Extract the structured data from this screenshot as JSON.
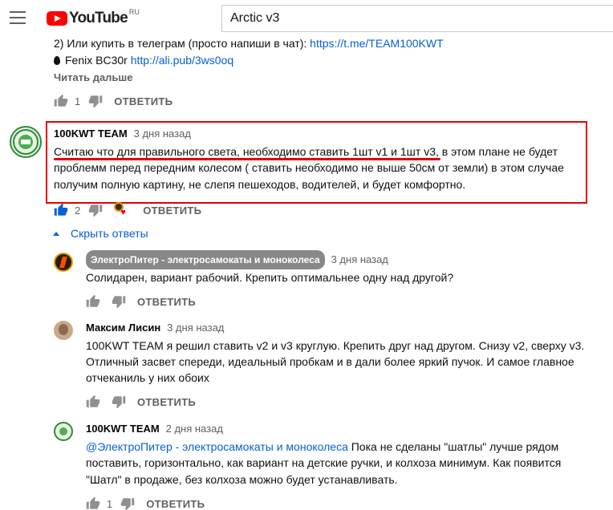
{
  "header": {
    "logo_text": "YouTube",
    "logo_region": "RU",
    "search_query": "Arctic v3"
  },
  "prev_comment": {
    "line1_text": "2) Или купить в телеграм (просто напиши в чат): ",
    "line1_link": "https://t.me/TEAM100KWT",
    "line2_text": "Fenix BC30r ",
    "line2_link": "http://ali.pub/3ws0oq",
    "read_more": "Читать дальше",
    "likes": "1",
    "reply": "ОТВЕТИТЬ"
  },
  "main_comment": {
    "author": "100KWT TEAM",
    "time": "3 дня назад",
    "lines": [
      "Считаю что для правильного света, необходимо ставить 1шт v1 и 1шт v3, в этом плане не будет",
      "проблемм перед передним колесом ( ставить необходимо не выше 50см от земли)  в этом случае",
      "получим полную картину, не слепя пешеходов, водителей, и будет комфортно."
    ],
    "likes": "2",
    "reply": "ОТВЕТИТЬ",
    "hide_replies": "Скрыть ответы"
  },
  "replies": [
    {
      "author": "ЭлектроПитер - электросамокаты и моноколеса",
      "time": "3 дня назад",
      "lines": [
        "Солидарен, вариант рабочий. Крепить оптимальнее одну над другой?"
      ],
      "likes": "",
      "reply": "ОТВЕТИТЬ"
    },
    {
      "author": "Максим Лисин",
      "time": "3 дня назад",
      "lines": [
        "100KWT TEAM я решил ставить v2 и v3 круглую. Крепить друг над другом. Снизу v2, сверху v3.",
        "Отличный засвет спереди, идеальный пробкам и в дали более яркий пучок. И самое главное",
        "отчеканиль у них обоих"
      ],
      "likes": "",
      "reply": "ОТВЕТИТЬ"
    },
    {
      "author": "100KWT TEAM",
      "time": "2 дня назад",
      "mention": "@ЭлектроПитер - электросамокаты и моноколеса",
      "line1_rest": " Пока не сделаны \"шатлы\" лучше рядом",
      "lines": [
        "поставить, горизонтально, как вариант на детские ручки, и колхоза минимум. Как появится",
        "\"Шатл\" в продаже, без колхоза можно будет устанавливать."
      ],
      "likes": "1",
      "reply": "ОТВЕТИТЬ"
    }
  ],
  "colors": {
    "accent": "#065fd4",
    "highlight": "#e50000",
    "logo_red": "#ff0000"
  }
}
